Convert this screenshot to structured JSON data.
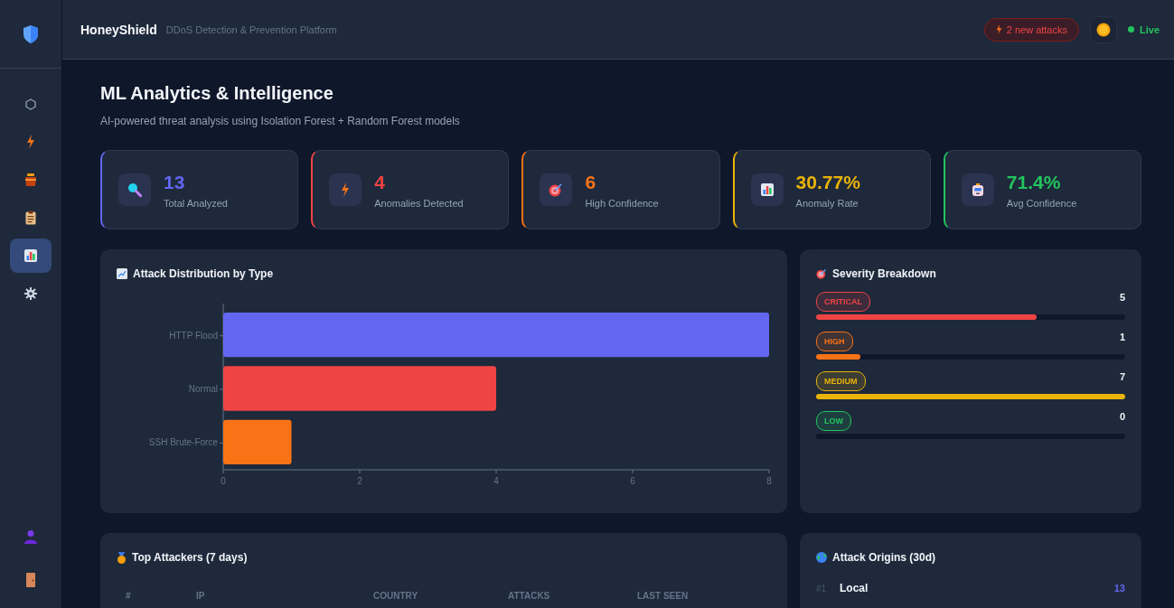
{
  "brand": {
    "name": "HoneyShield",
    "tagline": "DDoS Detection & Prevention Platform"
  },
  "header": {
    "alert": "2 new attacks",
    "status": "Live"
  },
  "sidebar": {
    "items": [
      {
        "kind": "hexagon",
        "selected": false
      },
      {
        "kind": "bolt",
        "selected": false
      },
      {
        "kind": "pot",
        "selected": false
      },
      {
        "kind": "clipboard",
        "selected": false
      },
      {
        "kind": "chart",
        "selected": true
      },
      {
        "kind": "gear",
        "selected": false
      }
    ],
    "bottom": [
      {
        "kind": "person"
      },
      {
        "kind": "door"
      }
    ]
  },
  "page": {
    "title": "ML Analytics & Intelligence",
    "subtitle": "AI-powered threat analysis using Isolation Forest + Random Forest models"
  },
  "stats": [
    {
      "kind": "search",
      "value": "13",
      "label": "Total Analyzed",
      "color": "#6366f1"
    },
    {
      "kind": "bolt",
      "value": "4",
      "label": "Anomalies Detected",
      "color": "#ef4444"
    },
    {
      "kind": "target",
      "value": "6",
      "label": "High Confidence",
      "color": "#f97316"
    },
    {
      "kind": "chart",
      "value": "30.77%",
      "label": "Anomaly Rate",
      "color": "#eab308"
    },
    {
      "kind": "robot",
      "value": "71.4%",
      "label": "Avg Confidence",
      "color": "#22c55e"
    }
  ],
  "distribution": {
    "title": "Attack Distribution by Type",
    "chart_data": {
      "type": "bar",
      "orientation": "horizontal",
      "categories": [
        "HTTP Flood",
        "Normal",
        "SSH Brute-Force"
      ],
      "values": [
        8,
        4,
        1
      ],
      "colors": [
        "#6366f1",
        "#ef4444",
        "#f97316"
      ],
      "xlim": [
        0,
        8
      ],
      "xticks": [
        0,
        2,
        4,
        6,
        8
      ]
    }
  },
  "severity": {
    "title": "Severity Breakdown",
    "rows": [
      {
        "label": "CRITICAL",
        "count": "5",
        "level": 0.714,
        "color": "#ef4444"
      },
      {
        "label": "HIGH",
        "count": "1",
        "level": 0.143,
        "color": "#f97316"
      },
      {
        "label": "MEDIUM",
        "count": "7",
        "level": 1,
        "color": "#eab308"
      },
      {
        "label": "LOW",
        "count": "0",
        "level": 0,
        "color": "#22c55e"
      }
    ]
  },
  "top_attackers": {
    "title": "Top Attackers (7 days)",
    "columns": [
      "#",
      "IP",
      "COUNTRY",
      "ATTACKS",
      "LAST SEEN"
    ]
  },
  "origins": {
    "title": "Attack Origins (30d)",
    "rows": [
      {
        "rank": "#1",
        "name": "Local",
        "count": "13"
      }
    ]
  }
}
